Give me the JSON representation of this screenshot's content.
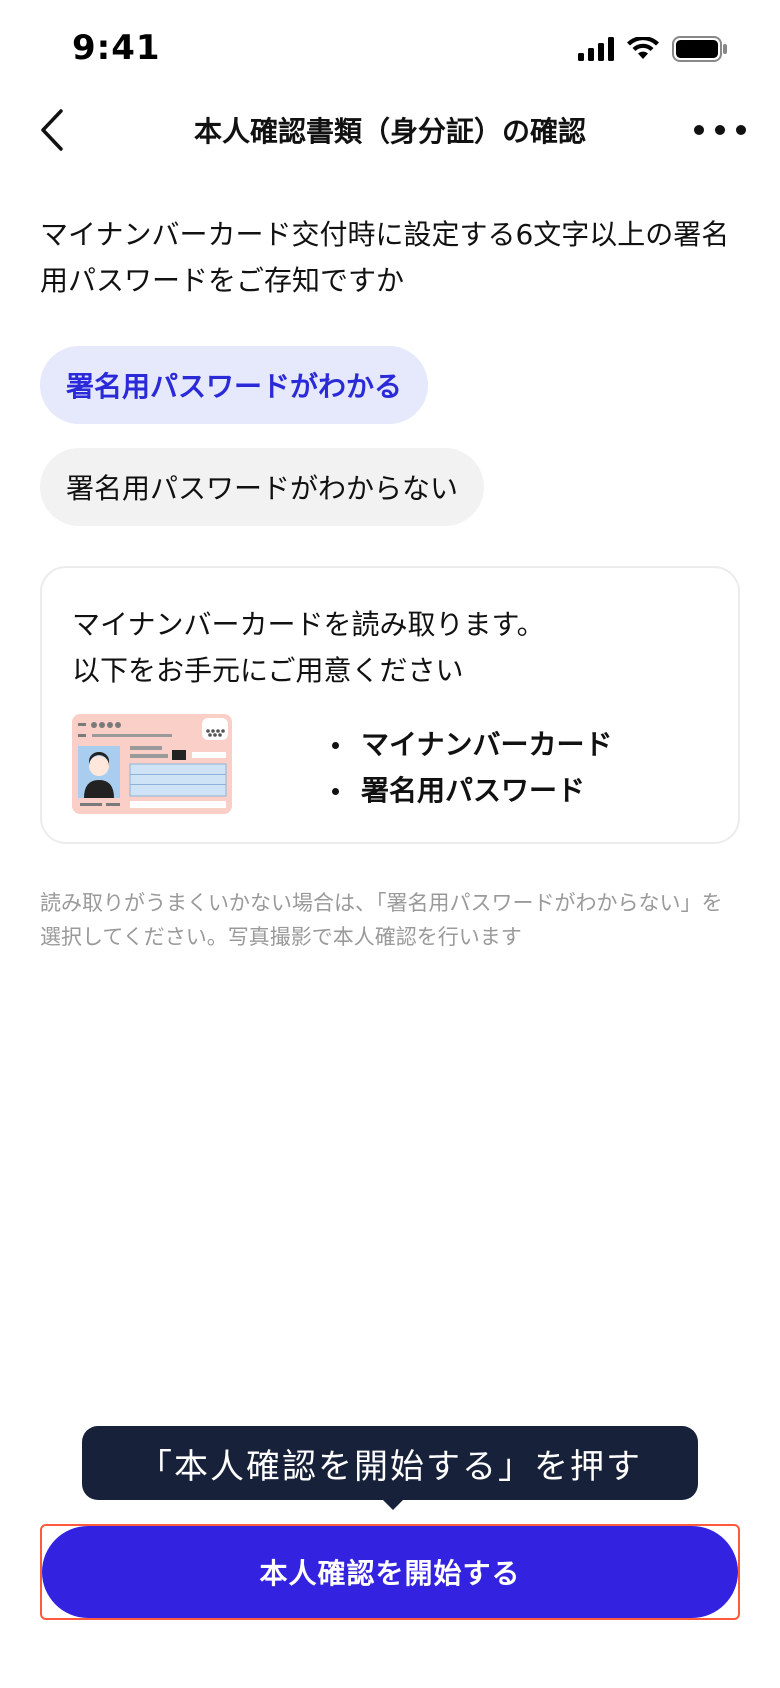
{
  "status_bar": {
    "time": "9:41"
  },
  "nav": {
    "title": "本人確認書類（身分証）の確認"
  },
  "question": "マイナンバーカード交付時に設定する6文字以上の署名用パスワードをご存知ですか",
  "options": [
    {
      "label": "署名用パスワードがわかる",
      "selected": true
    },
    {
      "label": "署名用パスワードがわからない",
      "selected": false
    }
  ],
  "info_card": {
    "line1": "マイナンバーカードを読み取ります。",
    "line2": "以下をお手元にご用意ください",
    "items": [
      "マイナンバーカード",
      "署名用パスワード"
    ]
  },
  "note": "読み取りがうまくいかない場合は、「署名用パスワードがわからない」を選択してください。写真撮影で本人確認を行います",
  "tooltip": "「本人確認を開始する」を押す",
  "cta": {
    "label": "本人確認を開始する"
  },
  "colors": {
    "accent": "#3323e0",
    "selected_bg": "#e6e8fc",
    "selected_text": "#2a2ad8",
    "tooltip_bg": "#17213a",
    "highlight_border": "#ff5a3c"
  }
}
